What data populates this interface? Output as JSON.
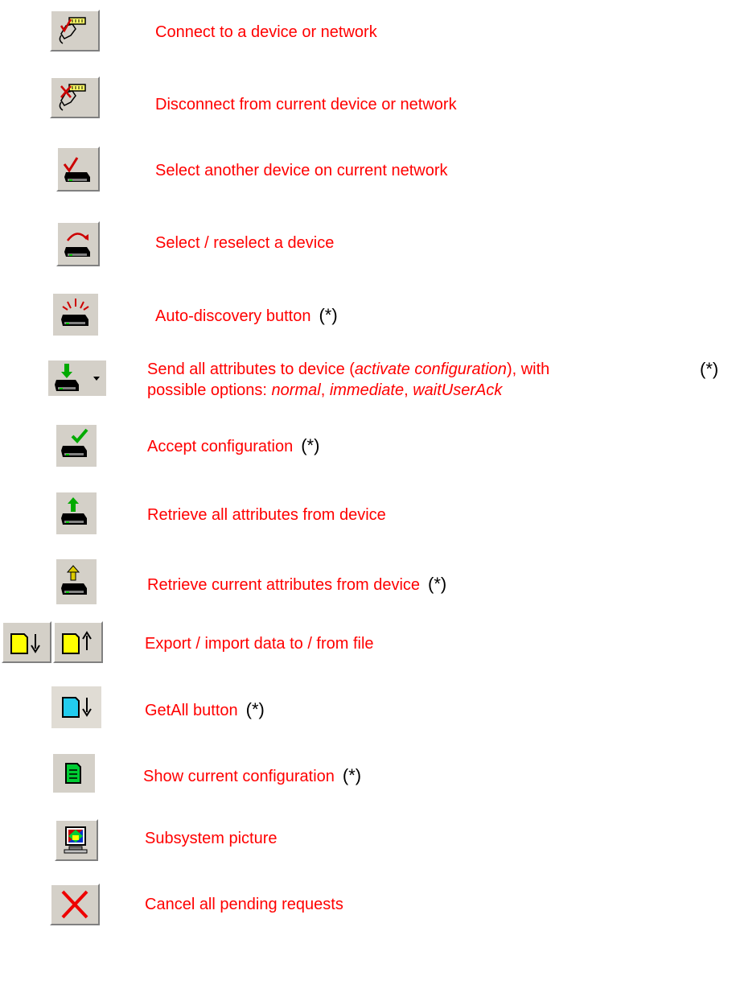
{
  "items": [
    {
      "icon": "connect-icon",
      "label": "Connect to a device or network",
      "star": ""
    },
    {
      "icon": "disconnect-icon",
      "label": "Disconnect from current device or network",
      "star": ""
    },
    {
      "icon": "select-device-check-icon",
      "label": "Select another device on current network",
      "star": ""
    },
    {
      "icon": "reselect-device-icon",
      "label": "Select / reselect a device",
      "star": ""
    },
    {
      "icon": "auto-discovery-icon",
      "label": "Auto-discovery button",
      "star": "(*)"
    },
    {
      "icon": "send-attributes-icon",
      "label_parts": {
        "a": "Send all attributes to device (",
        "b": "activate configuration",
        "c": "), with",
        "d": "possible options: ",
        "e": "normal",
        "f": ", ",
        "g": "immediate",
        "h": ", ",
        "i": "waitUserAck"
      },
      "star": "(*)"
    },
    {
      "icon": "accept-configuration-icon",
      "label": "Accept configuration",
      "star": "(*)"
    },
    {
      "icon": "retrieve-all-icon",
      "label": "Retrieve all attributes from device",
      "star": ""
    },
    {
      "icon": "retrieve-current-icon",
      "label": "Retrieve current attributes from device",
      "star": "(*)"
    },
    {
      "icon": "export-import-icon",
      "label": "Export / import data to / from file",
      "star": ""
    },
    {
      "icon": "getall-icon",
      "label": "GetAll button",
      "star": "(*)"
    },
    {
      "icon": "show-configuration-icon",
      "label": "Show current configuration",
      "star": "(*)"
    },
    {
      "icon": "subsystem-picture-icon",
      "label": "Subsystem picture",
      "star": ""
    },
    {
      "icon": "cancel-requests-icon",
      "label": "Cancel all pending requests",
      "star": ""
    }
  ]
}
